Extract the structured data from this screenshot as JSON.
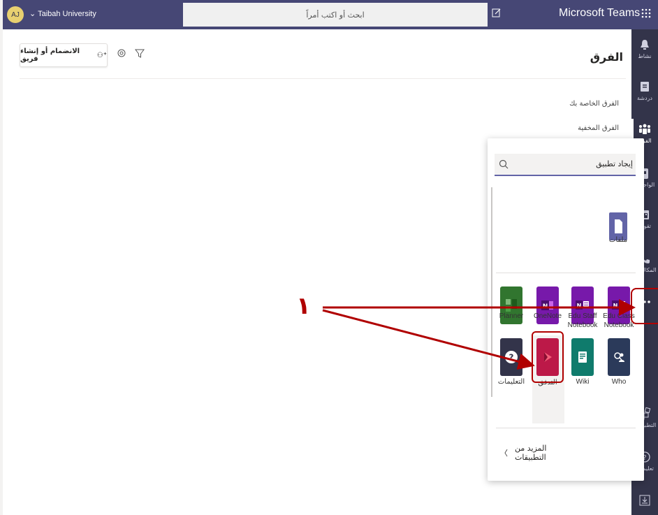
{
  "topbar": {
    "avatar_initials": "AJ",
    "org_name": "Taibah University",
    "search_placeholder": "ابحث أو اكتب أمراً",
    "app_title": "Microsoft Teams"
  },
  "header": {
    "title": "الفرق",
    "join_button": "الانضمام أو إنشاء فريق"
  },
  "teams_list": {
    "your_teams": "الفرق الخاصة بك",
    "hidden_teams": "الفرق المخفية"
  },
  "rail": {
    "items": [
      {
        "label": "نشاط",
        "icon": "bell-icon"
      },
      {
        "label": "دردشة",
        "icon": "chat-icon"
      },
      {
        "label": "الفرق",
        "icon": "teams-icon"
      },
      {
        "label": "الواجبات",
        "icon": "assignments-icon"
      },
      {
        "label": "تقويم",
        "icon": "calendar-icon"
      },
      {
        "label": "المكالمات",
        "icon": "phone-icon"
      },
      {
        "label": "",
        "icon": "more-icon"
      },
      {
        "label": "التطبيقات",
        "icon": "apps-icon"
      },
      {
        "label": "تعليمات",
        "icon": "help-icon"
      }
    ]
  },
  "flyout": {
    "search_value": "إيجاد تطبيق",
    "pinned": [
      {
        "label": "ملفات",
        "icon": "file-icon"
      }
    ],
    "apps_row1": [
      {
        "label": "Planner",
        "icon": "planner-icon",
        "color": "#31752f"
      },
      {
        "label": "OneNote",
        "icon": "onenote-icon",
        "color": "#7719aa"
      },
      {
        "label": "Edu Staff Notebook",
        "icon": "staff-notebook-icon",
        "color": "#7719aa"
      },
      {
        "label": "Edu Class Notebook",
        "icon": "class-notebook-icon",
        "color": "#7719aa"
      }
    ],
    "apps_row2": [
      {
        "label": "التعليمات",
        "icon": "help-app-icon",
        "color": "#33344a"
      },
      {
        "label": "التدفق",
        "icon": "stream-icon",
        "color": "#bc1948"
      },
      {
        "label": "Wiki",
        "icon": "wiki-icon",
        "color": "#0f7b6c"
      },
      {
        "label": "Who",
        "icon": "who-icon",
        "color": "#2b3a5a"
      }
    ],
    "more_apps": "المزيد من التطبيقات"
  },
  "annotation": {
    "number": "١",
    "color": "#b00000"
  }
}
